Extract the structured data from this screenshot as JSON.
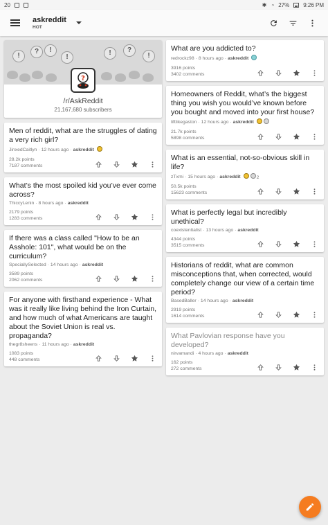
{
  "statusbar": {
    "left_text": "20",
    "battery": "27%",
    "time": "9:26 PM"
  },
  "appbar": {
    "subreddit": "askreddit",
    "sort": "HOT"
  },
  "header": {
    "name": "/r/AskReddit",
    "subscribers": "21,167,680 subscribers"
  },
  "left_posts": [
    {
      "title": "Men of reddit, what are the struggles of dating a very rich girl?",
      "author": "JinxedCaitlyn",
      "age": "12 hours ago",
      "sub": "askreddit",
      "points": "28.2k points",
      "comments": "7187 comments",
      "awards": [
        "gold"
      ],
      "award_count": ""
    },
    {
      "title": "What’s the most spoiled kid you’ve ever come across?",
      "author": "ThiccyLenin",
      "age": "8 hours ago",
      "sub": "askreddit",
      "points": "2179 points",
      "comments": "1283 comments",
      "awards": [],
      "award_count": ""
    },
    {
      "title": "If there was a class called \"How to be an Asshole: 101\", what would be on the curriculum?",
      "author": "SpeciallySelected",
      "age": "14 hours ago",
      "sub": "askreddit",
      "points": "3589 points",
      "comments": "2062 comments",
      "awards": [],
      "award_count": ""
    },
    {
      "title": "For anyone with firsthand experience - What was it really like living behind the Iron Curtain, and how much of what Americans are taught about the Soviet Union is real vs. propaganda?",
      "author": "thegr8sheens",
      "age": "11 hours ago",
      "sub": "askreddit",
      "points": "1083 points",
      "comments": "448 comments",
      "awards": [],
      "award_count": ""
    }
  ],
  "right_posts": [
    {
      "title": "What are you addicted to?",
      "author": "redrockz98",
      "age": "8 hours ago",
      "sub": "askreddit",
      "points": "3916 points",
      "comments": "3402 comments",
      "awards": [
        "teal"
      ],
      "award_count": ""
    },
    {
      "title": "Homeowners of Reddit, what’s the biggest thing you wish you would’ve known before you bought and moved into your first house?",
      "author": "liftlikegaston",
      "age": "12 hours ago",
      "sub": "askreddit",
      "points": "21.7k points",
      "comments": "5898 comments",
      "awards": [
        "gold",
        "silver"
      ],
      "award_count": ""
    },
    {
      "title": "What is an essential, not-so-obvious skill in life?",
      "author": "zTxmi",
      "age": "15 hours ago",
      "sub": "askreddit",
      "points": "50.5k points",
      "comments": "15623 comments",
      "awards": [
        "gold",
        "silver"
      ],
      "award_count": "2"
    },
    {
      "title": "What is perfectly legal but incredibly unethical?",
      "author": "coexistentialist",
      "age": "13 hours ago",
      "sub": "askreddit",
      "points": "4344 points",
      "comments": "3515 comments",
      "awards": [],
      "award_count": ""
    },
    {
      "title": "Historians of reddit, what are common misconceptions that, when corrected, would completely change our view of a certain time period?",
      "author": "BasedBaller",
      "age": "14 hours ago",
      "sub": "askreddit",
      "points": "2919 points",
      "comments": "1614 comments",
      "awards": [],
      "award_count": ""
    },
    {
      "title": "What Pavlovian response have you developed?",
      "author": "nirvamandi",
      "age": "4 hours ago",
      "sub": "askreddit",
      "points": "162 points",
      "comments": "272 comments",
      "awards": [],
      "award_count": "",
      "visited": true
    }
  ],
  "icons": {
    "menu": "hamburger-icon",
    "refresh": "refresh-icon",
    "sort": "sort-icon",
    "overflow": "more-vert-icon",
    "fab": "pencil-icon"
  },
  "colors": {
    "accent": "#f57c20",
    "background": "#ececec"
  }
}
